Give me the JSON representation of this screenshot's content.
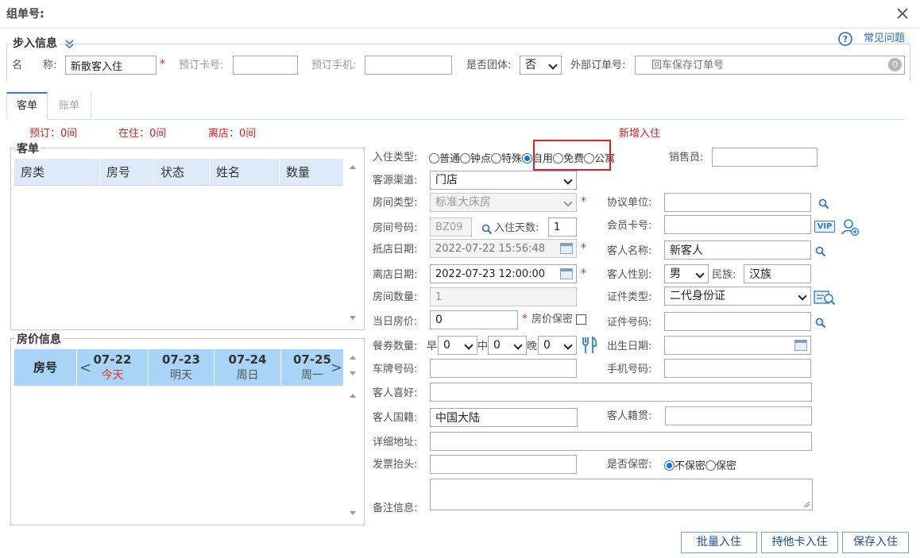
{
  "window": {
    "title": "组单号:"
  },
  "section": {
    "title": "步入信息",
    "help": "常见问题"
  },
  "top_form": {
    "name_label": "名　　称:",
    "name_value": "新散客入住",
    "booking_card_label": "预订卡号:",
    "booking_phone_label": "预订手机:",
    "is_group_label": "是否团体:",
    "is_group_value": "否",
    "external_order_label": "外部订单号:",
    "external_order_placeholder": "回车保存订单号",
    "external_count": "0"
  },
  "tabs": [
    {
      "label": "客单"
    },
    {
      "label": "账单"
    }
  ],
  "status": {
    "reserved": "预订：0间",
    "in_house": "在住：0间",
    "departing": "离店：0间",
    "new_checkin": "新增入住"
  },
  "guest_list": {
    "title": "客单",
    "columns": [
      "房类",
      "房号",
      "状态",
      "姓名",
      "数量"
    ]
  },
  "rate_panel": {
    "title": "房价信息",
    "room_label": "房号",
    "days": [
      {
        "date": "07-22",
        "label": "今天"
      },
      {
        "date": "07-23",
        "label": "明天"
      },
      {
        "date": "07-24",
        "label": "周日"
      },
      {
        "date": "07-25",
        "label": "周一"
      }
    ]
  },
  "form": {
    "checkin_type_label": "入住类型:",
    "checkin_types": [
      "普通",
      "钟点",
      "特殊",
      "自用",
      "免费",
      "公寓"
    ],
    "checkin_type_selected": "自用",
    "salesperson_label": "销售员:",
    "source_label": "客源渠道:",
    "source_value": "门店",
    "room_type_label": "房间类型:",
    "room_type_value": "标准大床房",
    "agreement_label": "协议单位:",
    "room_no_label": "房间号码:",
    "room_no_value": "BZ09",
    "nights_label": "入住天数:",
    "nights_value": "1",
    "member_card_label": "会员卡号:",
    "vip_label": "VIP",
    "arrival_label": "抵店日期:",
    "arrival_value": "2022-07-22 15:56:48",
    "guest_name_label": "客人名称:",
    "guest_name_value": "新客人",
    "departure_label": "离店日期:",
    "departure_value": "2022-07-23 12:00:00",
    "gender_label": "客人性别:",
    "gender_value": "男",
    "ethnicity_label": "民族:",
    "ethnicity_value": "汉族",
    "room_count_label": "房间数量:",
    "room_count_value": "1",
    "id_type_label": "证件类型:",
    "id_type_value": "二代身份证",
    "daily_rate_label": "当日房价:",
    "daily_rate_value": "0",
    "rate_secret_label": "房价保密",
    "id_no_label": "证件号码:",
    "meal_label": "餐券数量:",
    "breakfast_label": "早",
    "breakfast_value": "0",
    "lunch_label": "中",
    "lunch_value": "0",
    "dinner_label": "晚",
    "dinner_value": "0",
    "birthday_label": "出生日期:",
    "plate_label": "车牌号码:",
    "mobile_label": "手机号码:",
    "hobby_label": "客人喜好:",
    "nationality_label": "客人国籍:",
    "nationality_value": "中国大陆",
    "origin_label": "客人籍贯:",
    "address_label": "详细地址:",
    "invoice_label": "发票抬头:",
    "secret_label": "是否保密:",
    "secret_options": [
      "不保密",
      "保密"
    ],
    "secret_selected": "不保密",
    "remarks_label": "备注信息:"
  },
  "buttons": {
    "batch": "批量入住",
    "other_card": "持他卡入住",
    "save": "保存入住"
  },
  "colors": {
    "accent": "#1a6fd1",
    "danger": "#e03030",
    "header_bg": "#dce9f8",
    "rate_header_bg": "#a9d4f7"
  }
}
